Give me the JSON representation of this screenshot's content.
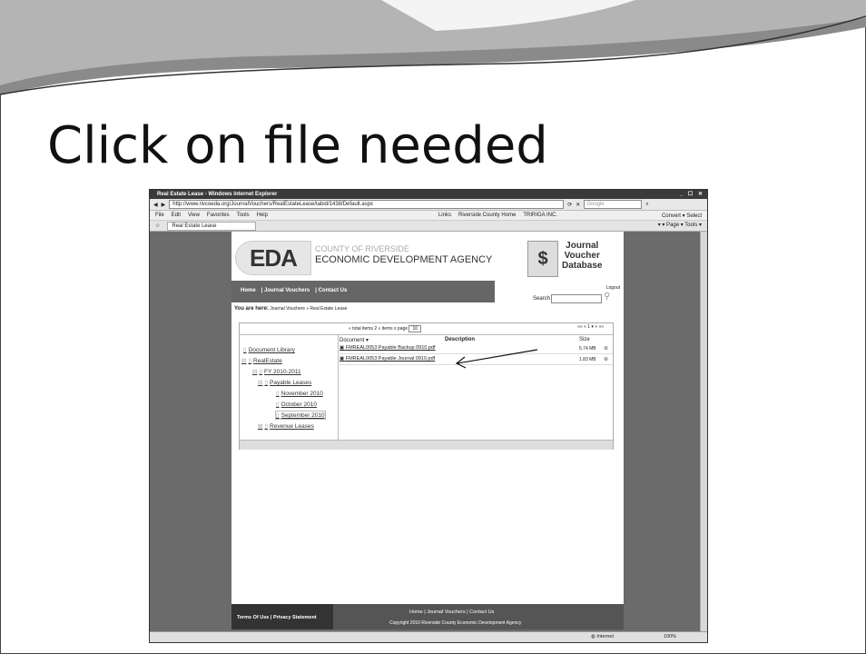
{
  "slide": {
    "title": "Click on file needed"
  },
  "browser": {
    "window_title": "Real Estate Lease - Windows Internet Explorer",
    "window_buttons": "_ ☐ ✕",
    "url": "http://www.rivcoeda.org/JournalVouchers/RealEstateLease/tabid/1438/Default.aspx",
    "search_placeholder": "Google",
    "menu": [
      "File",
      "Edit",
      "View",
      "Favorites",
      "Tools",
      "Help"
    ],
    "links_label": "Links",
    "links": [
      "Riverside County Home",
      "TRIRIGA INC."
    ],
    "menu_right": "Convert ▾  Select",
    "tab": "Real Estate Lease",
    "commands": "▾ ▾ Page ▾ Tools ▾",
    "status_zone": "Internet",
    "zoom": "100%"
  },
  "site": {
    "logo": "EDA",
    "agency_line1": "COUNTY OF RIVERSIDE",
    "agency_line2": "ECONOMIC DEVELOPMENT AGENCY",
    "jv_icon": "$",
    "jv_title": [
      "Journal",
      "Voucher",
      "Database"
    ],
    "nav": [
      "Home",
      "Journal Vouchers",
      "Contact Us"
    ],
    "logout": "Logout",
    "search_label": "Search",
    "breadcrumb_label": "You are here:",
    "breadcrumb": "Journal Vouchers » Real Estate Lease"
  },
  "pager": {
    "info": "« total items 2  « items x page",
    "per_page": "10",
    "page": "1",
    "nav": "«« «  1 ▾  » »»"
  },
  "tree": [
    {
      "label": "Document Library",
      "prefix": ""
    },
    {
      "label": "RealEstate",
      "prefix": "⊟"
    },
    {
      "label": "FY 2010-2011",
      "prefix": "⊟"
    },
    {
      "label": "Payable Leases",
      "prefix": "⊟"
    },
    {
      "label": "November 2010",
      "prefix": ""
    },
    {
      "label": "October 2010",
      "prefix": ""
    },
    {
      "label": "September 2010",
      "prefix": ""
    },
    {
      "label": "Revenue Leases",
      "prefix": "⊞"
    }
  ],
  "grid": {
    "headers": {
      "document": "Document ▾",
      "description": "Description",
      "size": "Size"
    },
    "rows": [
      {
        "document": "FMREAL0053 Payable Backup 0910.pdf",
        "size": "5.74 MB"
      },
      {
        "document": "FMREAL0053 Payable Journal 0910.pdf",
        "size": "1.83 MB"
      }
    ]
  },
  "footer": {
    "left": "Terms Of Use  |  Privacy Statement",
    "center": "Home  |  Journal Vouchers  |  Contact Us",
    "copyright": "Copyright 2010 Riverside County Economic Development Agency"
  }
}
